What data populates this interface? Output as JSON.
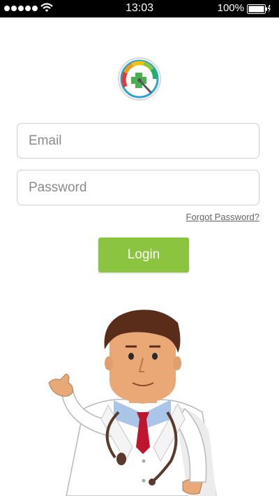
{
  "status_bar": {
    "time": "13:03",
    "battery_percent": "100%",
    "signal_bars": 5,
    "icons": [
      "signal-dots-icon",
      "wifi-icon",
      "battery-charging-icon"
    ]
  },
  "login_form": {
    "email_placeholder": "Email",
    "password_placeholder": "Password",
    "forgot_password_label": "Forgot Password?",
    "login_label": "Login"
  },
  "colors": {
    "accent": "#8bc53f",
    "status_bar_bg": "#000000",
    "input_border": "#cfcfcf",
    "link_text": "#666666"
  },
  "illustration": {
    "logo": "health-gauge-logo",
    "hero": "doctor-thumbs-up-illustration"
  }
}
